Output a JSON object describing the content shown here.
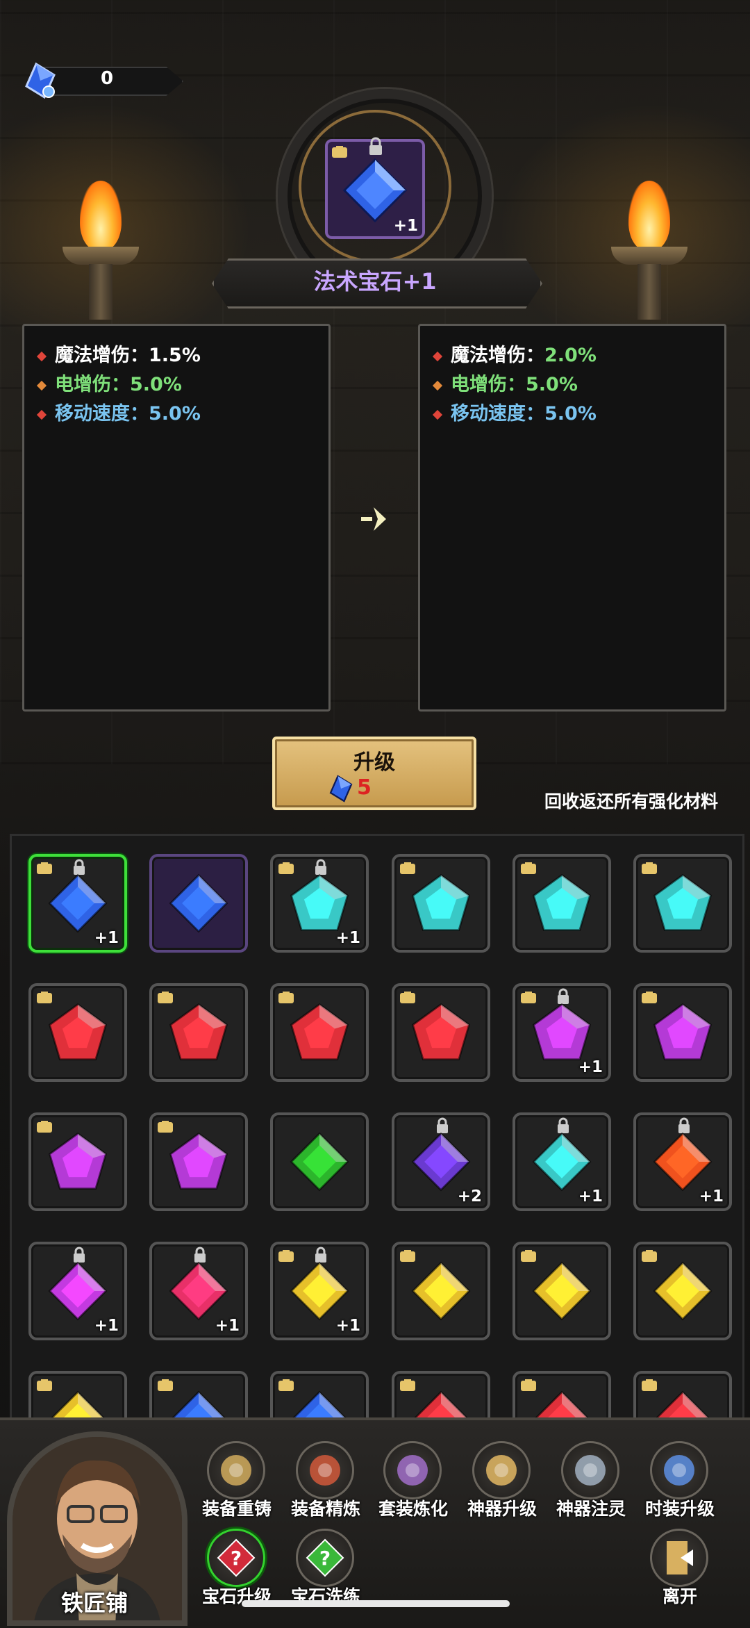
{
  "currency": {
    "value": "0",
    "icon": "blue-gem-currency-icon"
  },
  "featured": {
    "name": "法术宝石+1",
    "level": "+1",
    "gem_color": "#2f63e6",
    "gem_shape": "diamond"
  },
  "current_stats": [
    {
      "label": "魔法增伤：",
      "value": "1.5%",
      "color": "#ffffff",
      "dot": "#e0453a"
    },
    {
      "label": "电增伤：",
      "value": "5.0%",
      "color": "#7fe07a",
      "dot": "#e48a3a"
    },
    {
      "label": "移动速度：",
      "value": "5.0%",
      "color": "#7ac4f0",
      "dot": "#e0453a"
    }
  ],
  "next_stats": [
    {
      "label": "魔法增伤：",
      "value": "2.0%",
      "color": "#ffffff",
      "value_color": "#7fe07a",
      "dot": "#e0453a"
    },
    {
      "label": "电增伤：",
      "value": "5.0%",
      "color": "#7fe07a",
      "dot": "#e48a3a"
    },
    {
      "label": "移动速度：",
      "value": "5.0%",
      "color": "#7ac4f0",
      "dot": "#e0453a"
    }
  ],
  "upgrade": {
    "label": "升级",
    "cost": "5"
  },
  "recycle_text": "回收返还所有强化材料",
  "inventory": [
    {
      "shape": "diamond",
      "color": "#2f63e6",
      "coin": true,
      "lock": true,
      "plus": "+1",
      "bg": "selected"
    },
    {
      "shape": "diamond",
      "color": "#2f63e6",
      "coin": false,
      "lock": false,
      "plus": "",
      "bg": "purple"
    },
    {
      "shape": "pentagon",
      "color": "#39c8c6",
      "coin": true,
      "lock": true,
      "plus": "+1",
      "bg": ""
    },
    {
      "shape": "pentagon",
      "color": "#39c8c6",
      "coin": true,
      "lock": false,
      "plus": "",
      "bg": ""
    },
    {
      "shape": "pentagon",
      "color": "#39c8c6",
      "coin": true,
      "lock": false,
      "plus": "",
      "bg": ""
    },
    {
      "shape": "pentagon",
      "color": "#39c8c6",
      "coin": true,
      "lock": false,
      "plus": "",
      "bg": ""
    },
    {
      "shape": "pentagon",
      "color": "#e0303a",
      "coin": true,
      "lock": false,
      "plus": "",
      "bg": ""
    },
    {
      "shape": "pentagon",
      "color": "#e0303a",
      "coin": true,
      "lock": false,
      "plus": "",
      "bg": ""
    },
    {
      "shape": "pentagon",
      "color": "#e0303a",
      "coin": true,
      "lock": false,
      "plus": "",
      "bg": ""
    },
    {
      "shape": "pentagon",
      "color": "#e0303a",
      "coin": true,
      "lock": false,
      "plus": "",
      "bg": ""
    },
    {
      "shape": "pentagon",
      "color": "#b43ad6",
      "coin": true,
      "lock": true,
      "plus": "+1",
      "bg": ""
    },
    {
      "shape": "pentagon",
      "color": "#b43ad6",
      "coin": true,
      "lock": false,
      "plus": "",
      "bg": ""
    },
    {
      "shape": "pentagon",
      "color": "#b43ad6",
      "coin": true,
      "lock": false,
      "plus": "",
      "bg": ""
    },
    {
      "shape": "pentagon",
      "color": "#b43ad6",
      "coin": true,
      "lock": false,
      "plus": "",
      "bg": ""
    },
    {
      "shape": "diamond",
      "color": "#2cb52c",
      "coin": false,
      "lock": false,
      "plus": "",
      "bg": ""
    },
    {
      "shape": "diamond",
      "color": "#6a3ad0",
      "coin": false,
      "lock": true,
      "plus": "+2",
      "bg": ""
    },
    {
      "shape": "diamond",
      "color": "#39c8c6",
      "coin": false,
      "lock": true,
      "plus": "+1",
      "bg": ""
    },
    {
      "shape": "diamond",
      "color": "#f0521e",
      "coin": false,
      "lock": true,
      "plus": "+1",
      "bg": ""
    },
    {
      "shape": "diamond",
      "color": "#c33ae0",
      "coin": false,
      "lock": true,
      "plus": "+1",
      "bg": ""
    },
    {
      "shape": "diamond",
      "color": "#e83068",
      "coin": false,
      "lock": true,
      "plus": "+1",
      "bg": ""
    },
    {
      "shape": "diamond",
      "color": "#e6c02a",
      "coin": true,
      "lock": true,
      "plus": "+1",
      "bg": ""
    },
    {
      "shape": "diamond",
      "color": "#e6c02a",
      "coin": true,
      "lock": false,
      "plus": "",
      "bg": ""
    },
    {
      "shape": "diamond",
      "color": "#e6c02a",
      "coin": true,
      "lock": false,
      "plus": "",
      "bg": ""
    },
    {
      "shape": "diamond",
      "color": "#e6c02a",
      "coin": true,
      "lock": false,
      "plus": "",
      "bg": ""
    },
    {
      "shape": "diamond",
      "color": "#e6c02a",
      "coin": true,
      "lock": false,
      "plus": "",
      "bg": ""
    },
    {
      "shape": "diamond",
      "color": "#2f63e6",
      "coin": true,
      "lock": false,
      "plus": "",
      "bg": ""
    },
    {
      "shape": "diamond",
      "color": "#2f63e6",
      "coin": true,
      "lock": false,
      "plus": "",
      "bg": ""
    },
    {
      "shape": "diamond",
      "color": "#e0303a",
      "coin": true,
      "lock": false,
      "plus": "",
      "bg": ""
    },
    {
      "shape": "diamond",
      "color": "#e0303a",
      "coin": true,
      "lock": false,
      "plus": "",
      "bg": ""
    },
    {
      "shape": "diamond",
      "color": "#e0303a",
      "coin": true,
      "lock": false,
      "plus": "",
      "bg": ""
    }
  ],
  "shop_name": "铁匠铺",
  "functions": [
    {
      "label": "装备重铸",
      "icon": "helmet-icon",
      "color": "#c8a45a"
    },
    {
      "label": "装备精炼",
      "icon": "armor-icon",
      "color": "#c8563a"
    },
    {
      "label": "套装炼化",
      "icon": "cuff-icon",
      "color": "#9a6ac0"
    },
    {
      "label": "神器升级",
      "icon": "winged-sword-icon",
      "color": "#d8b060"
    },
    {
      "label": "神器注灵",
      "icon": "sword-icon",
      "color": "#9aa8b8"
    },
    {
      "label": "时装升级",
      "icon": "costume-icon",
      "color": "#5a8ad8"
    },
    {
      "label": "宝石升级",
      "icon": "red-gem-question-icon",
      "color": "#d22a3a",
      "active": true
    },
    {
      "label": "宝石洗练",
      "icon": "green-gem-question-icon",
      "color": "#3ab83a"
    },
    {
      "label": "离开",
      "icon": "exit-door-icon",
      "color": "#d8b060"
    }
  ]
}
